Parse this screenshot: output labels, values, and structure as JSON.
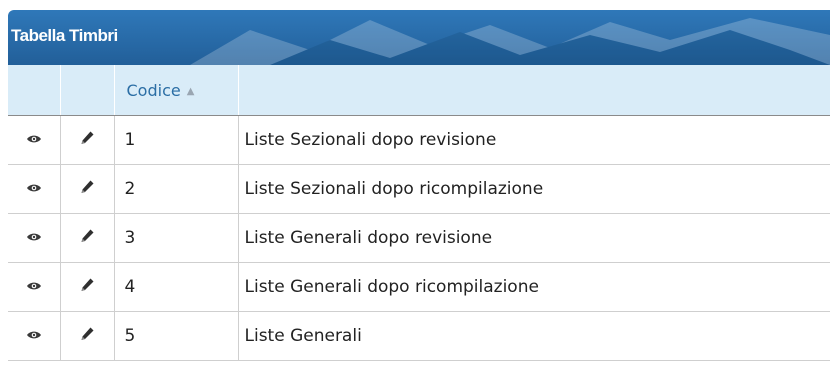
{
  "panel": {
    "title": "Tabella Timbri"
  },
  "table": {
    "columns": {
      "view": "",
      "edit": "",
      "code": "Codice",
      "description": ""
    },
    "sort_icon": "sort-icon",
    "rows": [
      {
        "code": "1",
        "description": "Liste Sezionali dopo revisione",
        "view_icon": "eye-icon",
        "edit_icon": "pencil-icon"
      },
      {
        "code": "2",
        "description": "Liste Sezionali dopo ricompilazione",
        "view_icon": "eye-icon",
        "edit_icon": "pencil-icon"
      },
      {
        "code": "3",
        "description": "Liste Generali dopo revisione",
        "view_icon": "eye-icon",
        "edit_icon": "pencil-icon"
      },
      {
        "code": "4",
        "description": "Liste Generali dopo ricompilazione",
        "view_icon": "eye-icon",
        "edit_icon": "pencil-icon"
      },
      {
        "code": "5",
        "description": "Liste Generali",
        "view_icon": "eye-icon",
        "edit_icon": "pencil-icon"
      }
    ]
  },
  "colors": {
    "titlebar": "#2a6dab",
    "header_bg": "#d9ecf8",
    "header_text": "#2b6ea5",
    "grid": "#cfcfcf"
  }
}
